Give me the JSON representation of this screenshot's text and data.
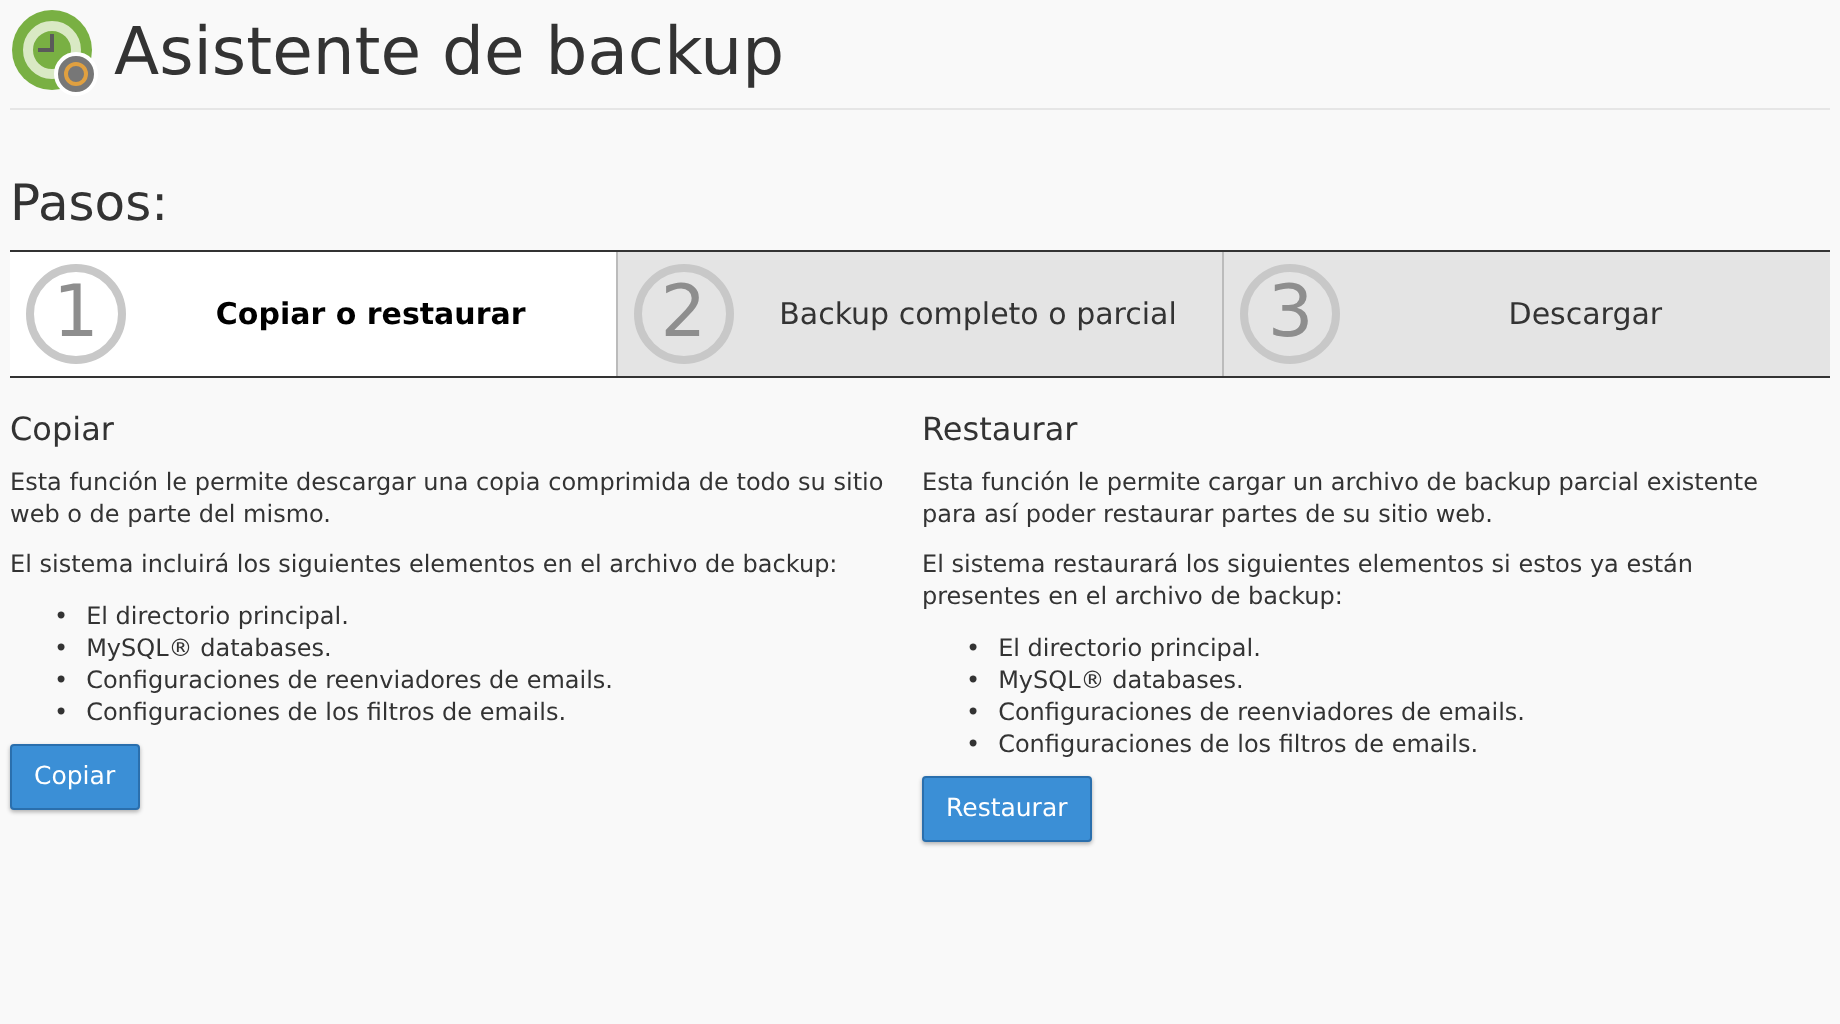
{
  "page": {
    "title": "Asistente de backup"
  },
  "steps_heading": "Pasos:",
  "steps": [
    {
      "number": "1",
      "label": "Copiar o restaurar",
      "selected": true
    },
    {
      "number": "2",
      "label": "Backup completo o parcial",
      "selected": false
    },
    {
      "number": "3",
      "label": "Descargar",
      "selected": false
    }
  ],
  "sections": [
    {
      "heading": "Copiar",
      "paragraphs": [
        "Esta función le permite descargar una copia comprimida de todo su sitio web o de parte del mismo.",
        "El sistema incluirá los siguientes elementos en el archivo de backup:"
      ],
      "items": [
        "El directorio principal.",
        "MySQL® databases.",
        "Configuraciones de reenviadores de emails.",
        "Configuraciones de los filtros de emails."
      ],
      "bullet": "•",
      "button": "Copiar"
    },
    {
      "heading": "Restaurar",
      "paragraphs": [
        "Esta función le permite cargar un archivo de backup parcial existente para así poder restaurar partes de su sitio web.",
        "El sistema restaurará los siguientes elementos si estos ya están presentes en el archivo de backup:"
      ],
      "items": [
        "El directorio principal.",
        "MySQL® databases.",
        "Configuraciones de reenviadores de emails.",
        "Configuraciones de los filtros de emails."
      ],
      "bullet": "•",
      "button": "Restaurar"
    }
  ]
}
